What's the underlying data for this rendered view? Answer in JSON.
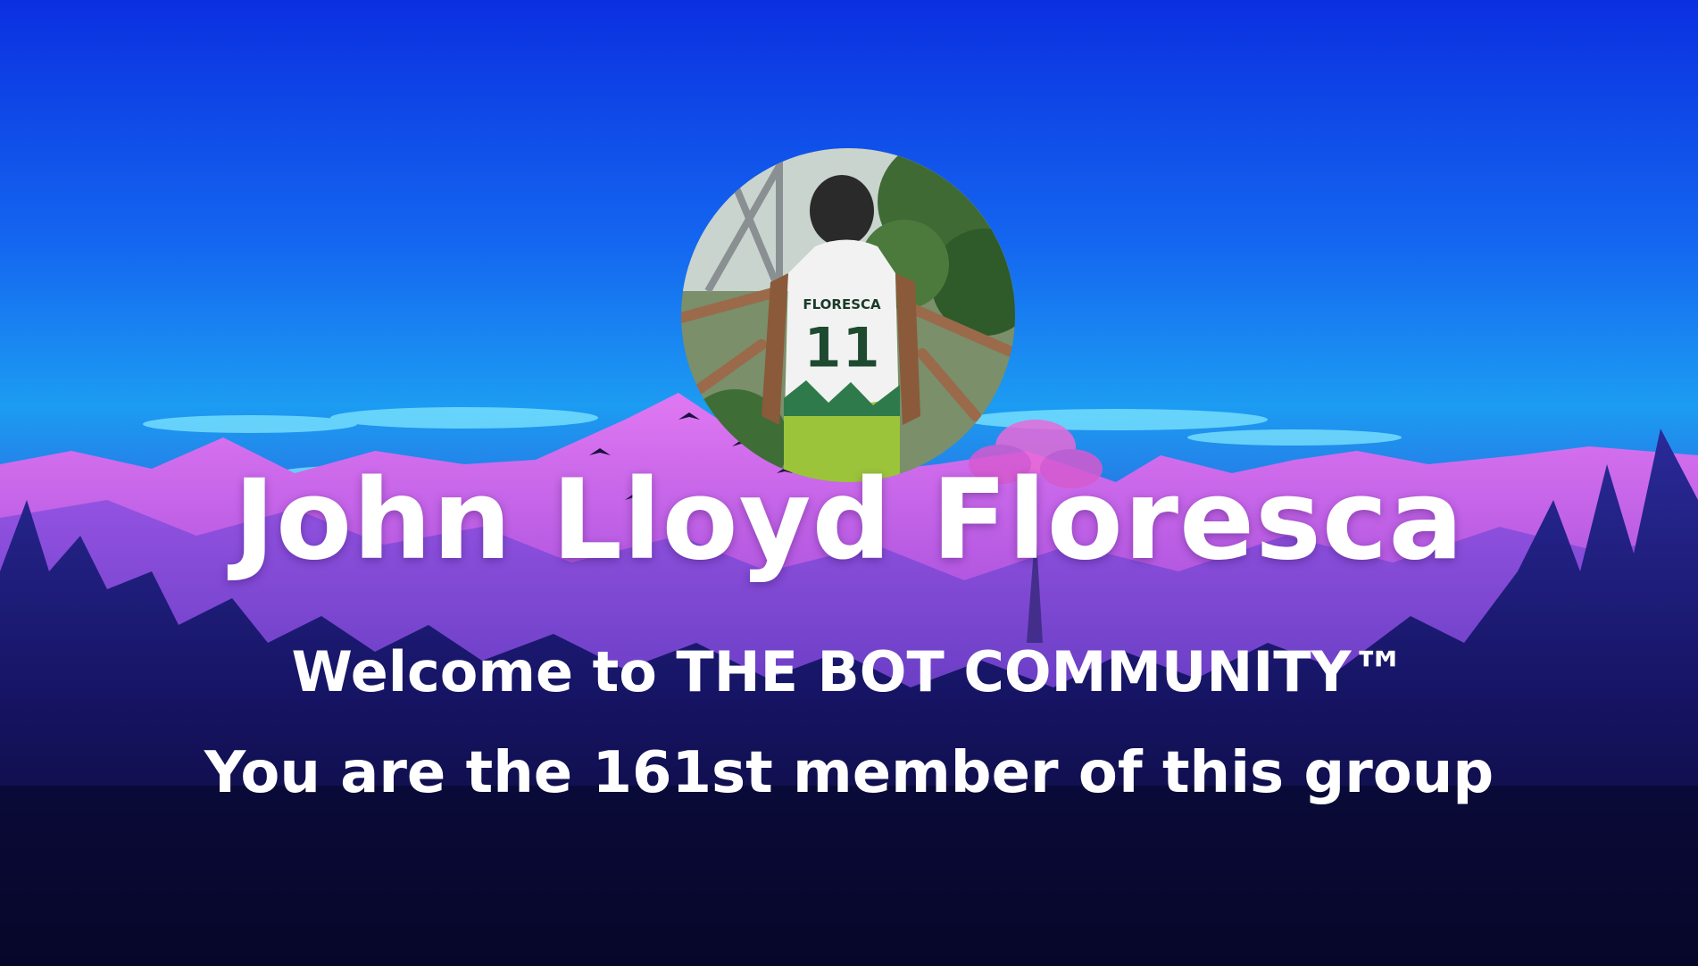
{
  "member": {
    "name": "John Lloyd Floresca",
    "jersey_name": "FLORESCA",
    "jersey_number": "11"
  },
  "messages": {
    "welcome": "Welcome to THE BOT COMMUNITY™",
    "member_count": "You are the 161st member of this group"
  },
  "colors": {
    "sky_top": "#0d3ee6",
    "sky_mid": "#1a8cf0",
    "mountain_pink": "#c85ee8",
    "forest_dark": "#0a0a33",
    "text": "#ffffff"
  }
}
